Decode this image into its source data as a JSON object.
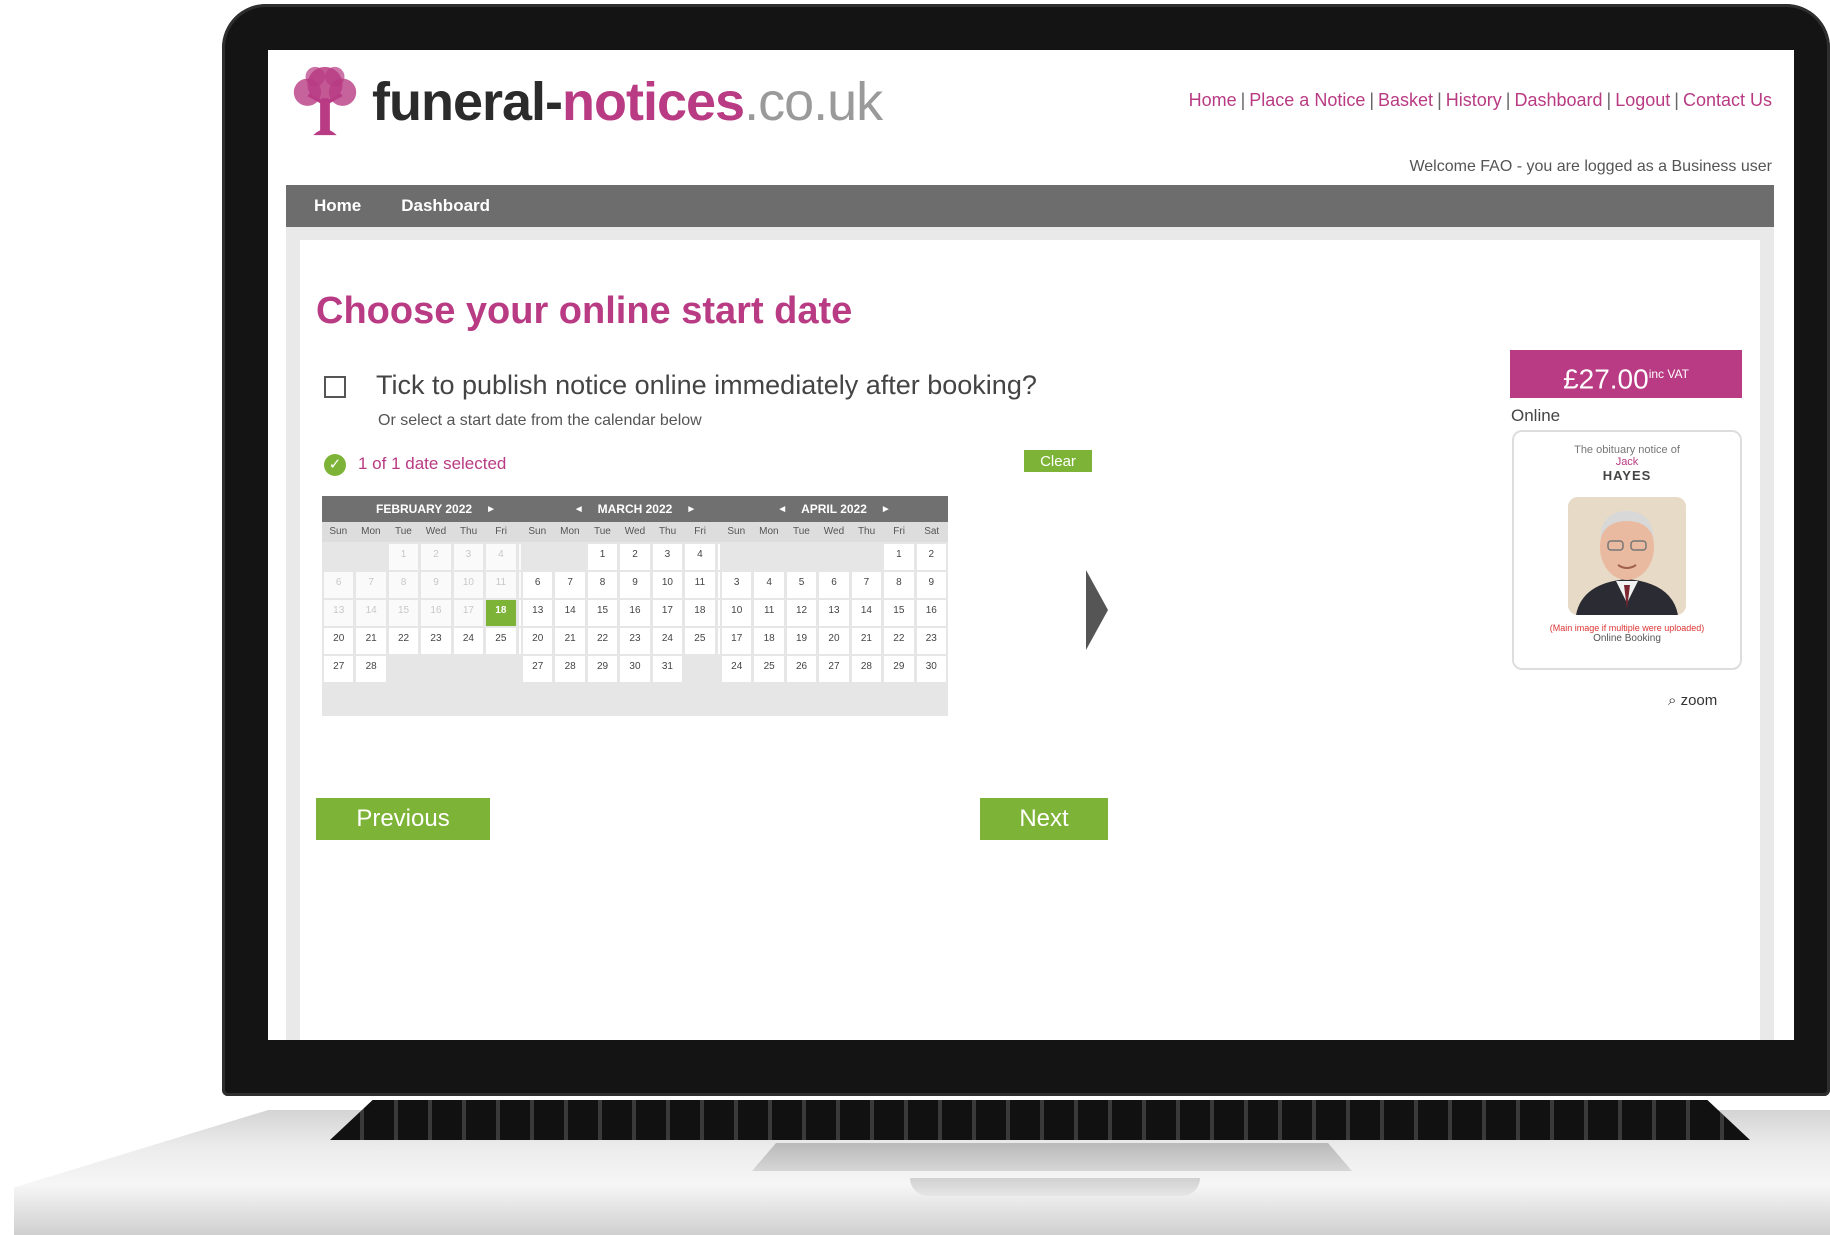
{
  "logo": {
    "part1": "funeral-",
    "part2": "notices",
    "part3": ".co.uk"
  },
  "top_nav": [
    "Home",
    "Place a Notice",
    "Basket",
    "History",
    "Dashboard",
    "Logout",
    "Contact Us"
  ],
  "welcome_text": "Welcome FAO - you are logged as a Business user",
  "menu": {
    "home": "Home",
    "dashboard": "Dashboard"
  },
  "page_title": "Choose your online start date",
  "tick_label": "Tick to publish notice online immediately after booking?",
  "tick_sub": "Or select a start date from the calendar below",
  "selection_status": "1 of 1 date selected",
  "clear_label": "Clear",
  "weekdays": [
    "Sun",
    "Mon",
    "Tue",
    "Wed",
    "Thu",
    "Fri",
    "Sat"
  ],
  "calendars": [
    {
      "title": "FEBRUARY 2022",
      "offset": 2,
      "days": 28,
      "past_before": 18,
      "selected": 18,
      "prev": false,
      "next": true
    },
    {
      "title": "MARCH 2022",
      "offset": 2,
      "days": 31,
      "past_before": 0,
      "selected": null,
      "prev": true,
      "next": true
    },
    {
      "title": "APRIL 2022",
      "offset": 5,
      "days": 30,
      "past_before": 0,
      "selected": null,
      "prev": true,
      "next": true
    }
  ],
  "buttons": {
    "previous": "Previous",
    "next": "Next"
  },
  "price": {
    "amount": "£27.00",
    "suffix": "inc VAT"
  },
  "online_label": "Online",
  "preview": {
    "intro": "The obituary notice of",
    "first_name": "Jack",
    "last_name": "HAYES",
    "note": "(Main image if multiple were uploaded)",
    "footer": "Online Booking"
  },
  "zoom_label": "zoom",
  "colors": {
    "accent": "#b83b83",
    "green": "#7db336",
    "nav_grey": "#6d6d6d"
  }
}
